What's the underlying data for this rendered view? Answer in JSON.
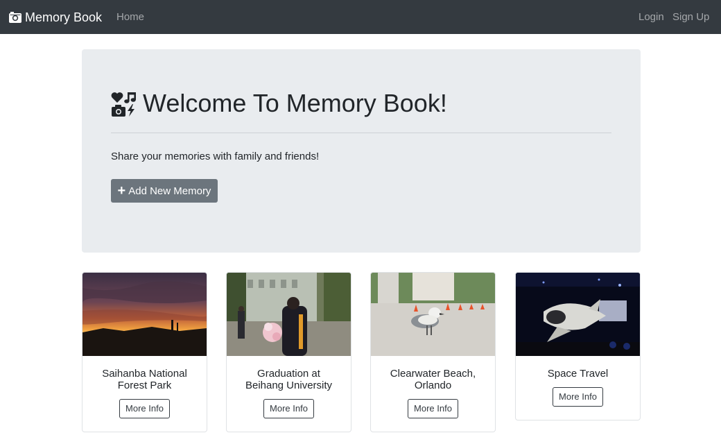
{
  "navbar": {
    "brand": "Memory Book",
    "home": "Home",
    "login": "Login",
    "signup": "Sign Up",
    "brand_icon": "camera-icon"
  },
  "jumbotron": {
    "title": "Welcome To Memory Book!",
    "title_icon": "memories-icon",
    "lead": "Share your memories with family and friends!",
    "add_button": "Add New Memory",
    "add_icon": "plus-icon"
  },
  "cards": [
    {
      "title": "Saihanba National Forest Park",
      "button": "More Info",
      "image": "sunset-forest-photo"
    },
    {
      "title": "Graduation at Beihang University",
      "button": "More Info",
      "image": "graduation-photo"
    },
    {
      "title": "Clearwater Beach, Orlando",
      "button": "More Info",
      "image": "seagull-beach-photo"
    },
    {
      "title": "Space Travel",
      "button": "More Info",
      "image": "space-shuttle-photo"
    }
  ],
  "colors": {
    "navbar_bg": "#343a40",
    "jumbotron_bg": "#e9ecef",
    "secondary_button": "#6c757d"
  }
}
